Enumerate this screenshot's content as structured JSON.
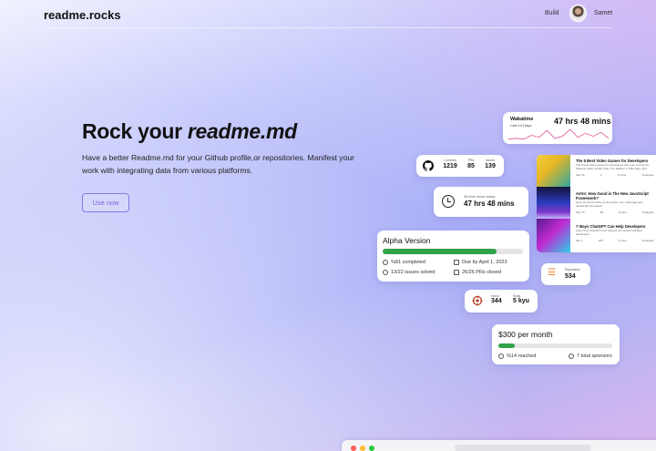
{
  "header": {
    "brand": "readme.rocks",
    "nav_build": "Build",
    "user_name": "Samet"
  },
  "hero": {
    "title_prefix": "Rock your ",
    "title_emphasis": "readme.md",
    "subtitle": "Have a better Readme.md for your Github profile,or repositories. Manifest your work with integrating data from various platforms.",
    "cta_label": "Use now"
  },
  "wakatime": {
    "title": "Wakatime",
    "subtitle": "Last 14 Days",
    "value": "47 hrs 48 mins",
    "sparkline": [
      2,
      3,
      2,
      6,
      4,
      11,
      3,
      5,
      12,
      4,
      8,
      5,
      9,
      3
    ]
  },
  "github": {
    "stats": [
      {
        "label": "Commits",
        "value": "1219"
      },
      {
        "label": "PRs",
        "value": "85"
      },
      {
        "label": "Issues",
        "value": "139"
      }
    ]
  },
  "alltime": {
    "label": "All time since today",
    "value": "47 hrs 48 mins"
  },
  "articles": [
    {
      "title": "The 5 Best Video Games for Developers",
      "desc": "The 5 best Video games for developers this year. Among Us, Stardew Valley, Ender King, The Witcher 3: Wild Hunt, and more.",
      "meta": [
        "Sep 15",
        "2",
        "8 mins",
        "Instagram"
      ]
    },
    {
      "title": "Astro: How Good is The New JavaScript Framework?",
      "desc": "Here are the benefits of using Astro, the multi-page app JavaScript framework.",
      "meta": [
        "Sep 15",
        "38",
        "6 mins",
        "Instagram"
      ]
    },
    {
      "title": "7 Ways ChatGPT Can Help Developers",
      "desc": "Learn how ChatGPT from OpenAI can benefit software developers.",
      "meta": [
        "Mar 1",
        "125",
        "5 mins",
        "Instagram"
      ]
    }
  ],
  "alpha": {
    "title": "Alpha Version",
    "progress": 0.81,
    "completed": "%81 completed",
    "due": "Due by April 1, 2023",
    "issues": "13/22 issues solved",
    "prs": "26/26 PRs closed"
  },
  "reputation": {
    "label": "Reputation",
    "value": "534"
  },
  "codewars": {
    "honor_label": "Honor",
    "honor": "344",
    "rank_label": "Rank",
    "rank": "5 kyu"
  },
  "sponsor": {
    "title": "$300 per month",
    "progress": 0.14,
    "reached": "%14 reached",
    "total": "7 total sponsors"
  },
  "colors": {
    "accent": "#7b61e0",
    "progress": "#2fa24a",
    "stackoverflow": "#f48024",
    "codewars": "#b1361e"
  }
}
